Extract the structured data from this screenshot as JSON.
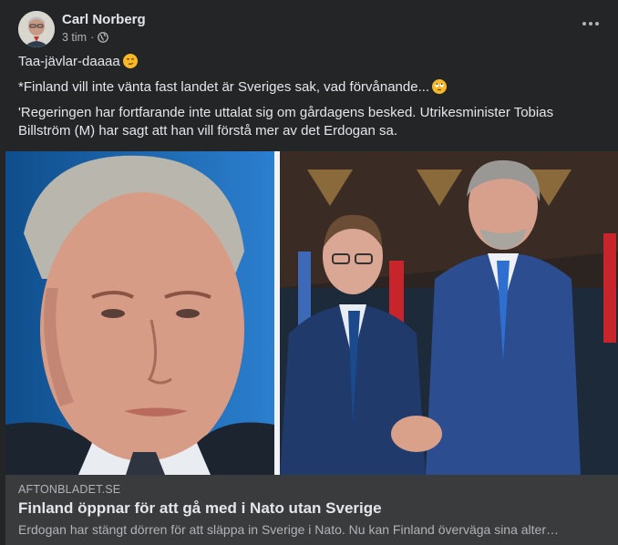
{
  "post": {
    "author": "Carl Norberg",
    "time": "3 tim",
    "separator": "·",
    "privacy_icon": "globe-icon",
    "menu_icon": "more-options-icon",
    "lines": [
      "Taa-jävlar-daaaa",
      "*Finland vill inte vänta fast landet är Sveriges sak, vad förvånande...",
      "'Regeringen har fortfarande inte uttalat sig om gårdagens besked. Utrikesminister Tobias Billström (M) har sagt att han vill förstå mer av det Erdogan sa."
    ],
    "emojis": [
      "smirking-face-emoji",
      "face-with-rolling-eyes-emoji"
    ]
  },
  "link_preview": {
    "domain": "AFTONBLADET.SE",
    "headline": "Finland öppnar för att gå med i Nato utan Sverige",
    "description": "Erdogan har stängt dörren för att släppa in Sverige i Nato. Nu kan Finland överväga sina alter…"
  },
  "colors": {
    "background": "#242526",
    "link_box": "#3a3b3c",
    "primary_text": "#e4e6eb",
    "secondary_text": "#b0b3b8"
  }
}
